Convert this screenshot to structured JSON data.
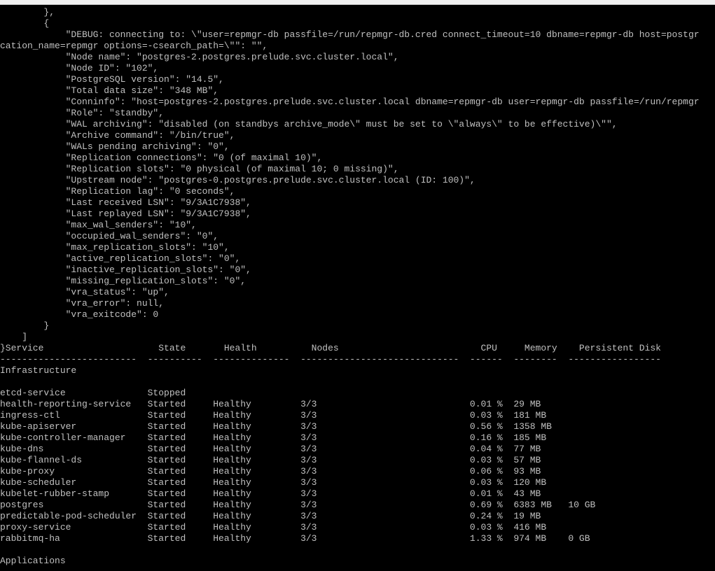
{
  "terminal": {
    "lines": [
      "        },",
      "        {",
      "            \"DEBUG: connecting to: \\\"user=repmgr-db passfile=/run/repmgr-db.cred connect_timeout=10 dbname=repmgr-db host=postgr",
      "cation_name=repmgr options=-csearch_path=\\\"\": \"\",",
      "            \"Node name\": \"postgres-2.postgres.prelude.svc.cluster.local\",",
      "            \"Node ID\": \"102\",",
      "            \"PostgreSQL version\": \"14.5\",",
      "            \"Total data size\": \"348 MB\",",
      "            \"Conninfo\": \"host=postgres-2.postgres.prelude.svc.cluster.local dbname=repmgr-db user=repmgr-db passfile=/run/repmgr",
      "            \"Role\": \"standby\",",
      "            \"WAL archiving\": \"disabled (on standbys archive_mode\\\" must be set to \\\"always\\\" to be effective)\\\"\",",
      "            \"Archive command\": \"/bin/true\",",
      "            \"WALs pending archiving\": \"0\",",
      "            \"Replication connections\": \"0 (of maximal 10)\",",
      "            \"Replication slots\": \"0 physical (of maximal 10; 0 missing)\",",
      "            \"Upstream node\": \"postgres-0.postgres.prelude.svc.cluster.local (ID: 100)\",",
      "            \"Replication lag\": \"0 seconds\",",
      "            \"Last received LSN\": \"9/3A1C7938\",",
      "            \"Last replayed LSN\": \"9/3A1C7938\",",
      "            \"max_wal_senders\": \"10\",",
      "            \"occupied_wal_senders\": \"0\",",
      "            \"max_replication_slots\": \"10\",",
      "            \"active_replication_slots\": \"0\",",
      "            \"inactive_replication_slots\": \"0\",",
      "            \"missing_replication_slots\": \"0\",",
      "            \"vra_status\": \"up\",",
      "            \"vra_error\": null,",
      "            \"vra_exitcode\": 0",
      "        }",
      "    ]",
      "}Service                     State       Health          Nodes                          CPU     Memory    Persistent Disk",
      "-------------------------  ----------  --------------  -----------------------------  ------  --------  -----------------",
      "Infrastructure",
      "",
      "etcd-service               Stopped",
      "health-reporting-service   Started     Healthy         3/3                            0.01 %  29 MB",
      "ingress-ctl                Started     Healthy         3/3                            0.03 %  181 MB",
      "kube-apiserver             Started     Healthy         3/3                            0.56 %  1358 MB",
      "kube-controller-manager    Started     Healthy         3/3                            0.16 %  185 MB",
      "kube-dns                   Started     Healthy         3/3                            0.04 %  77 MB",
      "kube-flannel-ds            Started     Healthy         3/3                            0.03 %  57 MB",
      "kube-proxy                 Started     Healthy         3/3                            0.06 %  93 MB",
      "kube-scheduler             Started     Healthy         3/3                            0.03 %  120 MB",
      "kubelet-rubber-stamp       Started     Healthy         3/3                            0.01 %  43 MB",
      "postgres                   Started     Healthy         3/3                            0.69 %  6383 MB   10 GB",
      "predictable-pod-scheduler  Started     Healthy         3/3                            0.24 %  19 MB",
      "proxy-service              Started     Healthy         3/3                            0.03 %  416 MB",
      "rabbitmq-ha                Started     Healthy         3/3                            1.33 %  974 MB    0 GB",
      "",
      "Applications"
    ]
  },
  "colors": {
    "background": "#000000",
    "foreground": "#c0c0c0",
    "top_strip": "#f0f0f0"
  }
}
